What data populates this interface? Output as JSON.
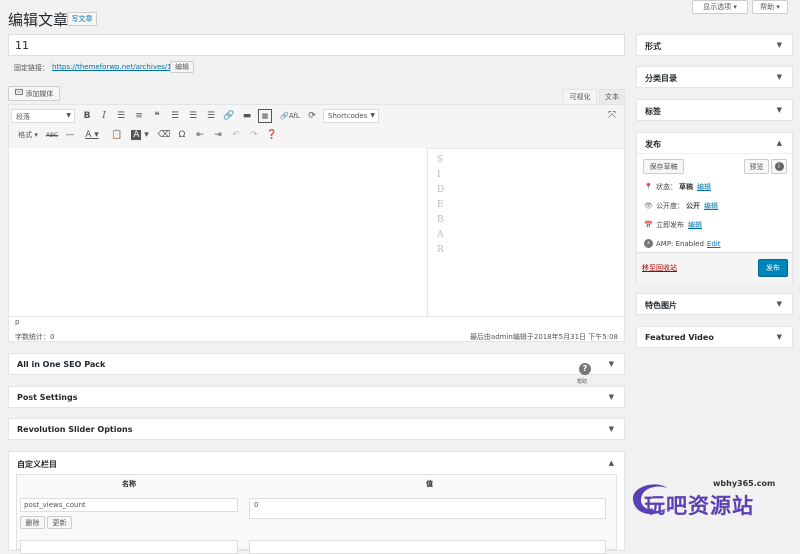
{
  "header": {
    "title": "编辑文章",
    "add_new": "写文章",
    "screen_options": "显示选项 ▾",
    "help": "帮助 ▾"
  },
  "post": {
    "title": "11",
    "permalink_label": "固定链接：",
    "permalink_url": "https://themeforwp.net/archives/11/",
    "permalink_edit": "编辑"
  },
  "editor": {
    "add_media": "添加媒体",
    "tab_visual": "可视化",
    "tab_text": "文本",
    "format_select": "段落",
    "shortcodes_select": "Shortcodes",
    "afl_label": "AfL",
    "row2_format": "格式",
    "path": "p",
    "word_count": "字数统计：0",
    "last_edited": "最后由admin编辑于2018年5月31日 下午5:08",
    "sidebar_letters": [
      "S",
      "I",
      "D",
      "E",
      "B",
      "A",
      "R"
    ]
  },
  "metaboxes": {
    "seo": "All in One SEO Pack",
    "seo_help": "?",
    "seo_help_text": "帮助",
    "post_settings": "Post Settings",
    "revslider": "Revolution Slider Options",
    "custom_fields": "自定义栏目",
    "col_name": "名称",
    "col_value": "值",
    "field1_name": "post_views_count",
    "field1_value": "0",
    "delete": "删除",
    "update": "更新"
  },
  "side": {
    "format": "形式",
    "categories": "分类目录",
    "tags": "标签",
    "publish": "发布",
    "save_draft": "保存草稿",
    "preview": "预览",
    "status_label": "状态：",
    "status_value": "草稿",
    "status_edit": "编辑",
    "visibility_label": "公开度：",
    "visibility_value": "公开",
    "visibility_edit": "编辑",
    "schedule_label": "立即发布",
    "schedule_edit": "编辑",
    "amp_label": "AMP: Enabled",
    "amp_edit": "Edit",
    "trash": "移至回收站",
    "publish_button": "发布",
    "featured_image": "特色图片",
    "featured_video": "Featured Video"
  },
  "watermark": {
    "url": "wbhy365.com",
    "name": "玩吧资源站"
  },
  "colors": {
    "accent": "#0073aa",
    "publish": "#0085ba",
    "trash": "#a00",
    "watermark": "#5b3fb5"
  }
}
